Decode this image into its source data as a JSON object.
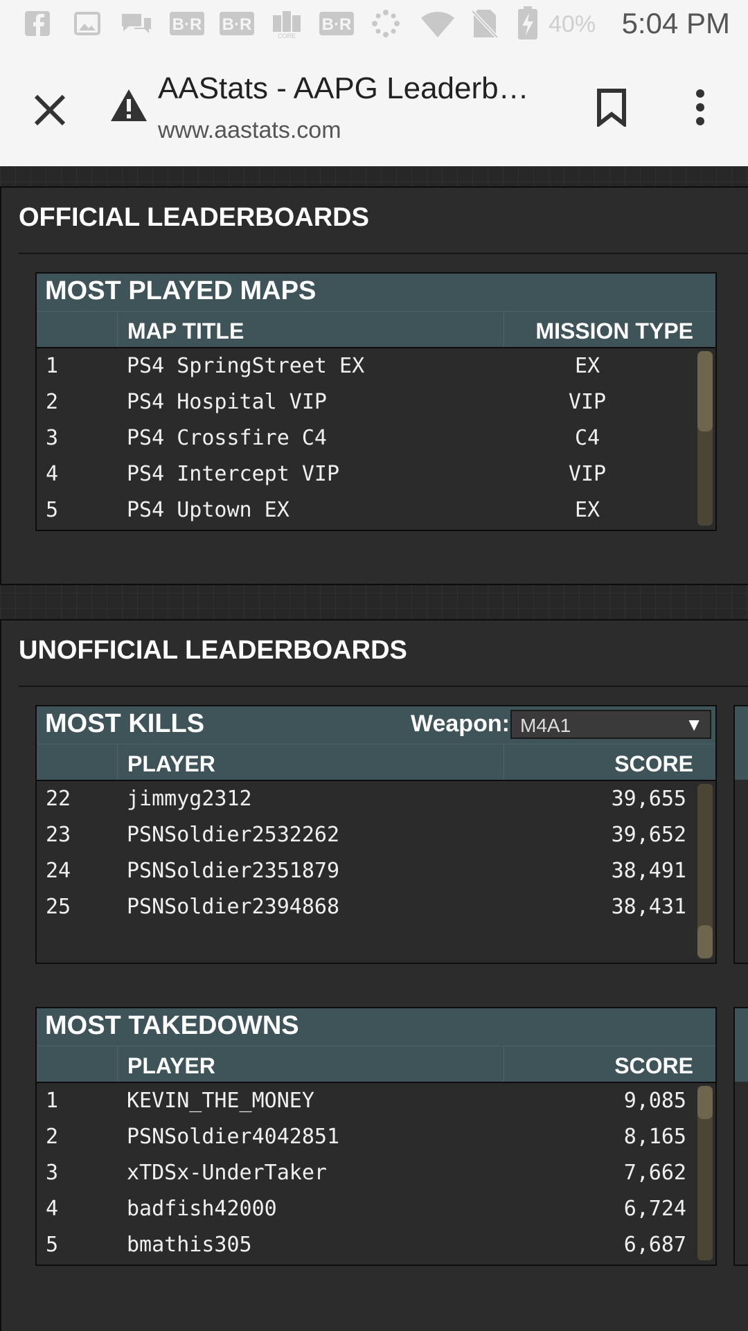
{
  "status_bar": {
    "time": "5:04 PM",
    "battery_percent": "40%",
    "icons": [
      "facebook-icon",
      "image-icon",
      "chat-icon",
      "b-r-icon",
      "b-r-icon",
      "core-icon",
      "b-r-icon",
      "dots-icon",
      "wifi-icon",
      "no-sim-icon",
      "battery-charging-icon"
    ]
  },
  "browser": {
    "title": "AAStats - AAPG Leaderb…",
    "url": "www.aastats.com",
    "icons": {
      "close": "close-icon",
      "warning": "warning-icon",
      "bookmark": "bookmark-icon",
      "menu": "more-vert-icon"
    }
  },
  "official": {
    "heading": "OFFICIAL LEADERBOARDS",
    "most_played_maps": {
      "title": "MOST PLAYED MAPS",
      "col_map": "MAP TITLE",
      "col_type": "MISSION TYPE",
      "rows": [
        {
          "rank": "1",
          "map": "PS4 SpringStreet EX",
          "type": "EX"
        },
        {
          "rank": "2",
          "map": "PS4 Hospital VIP",
          "type": "VIP"
        },
        {
          "rank": "3",
          "map": "PS4 Crossfire C4",
          "type": "C4"
        },
        {
          "rank": "4",
          "map": "PS4 Intercept VIP",
          "type": "VIP"
        },
        {
          "rank": "5",
          "map": "PS4 Uptown EX",
          "type": "EX"
        }
      ]
    }
  },
  "unofficial": {
    "heading": "UNOFFICIAL LEADERBOARDS",
    "most_kills": {
      "title": "MOST KILLS",
      "weapon_label": "Weapon:",
      "weapon_value": "M4A1",
      "col_player": "PLAYER",
      "col_score": "SCORE",
      "rows": [
        {
          "rank": "22",
          "player": "jimmyg2312",
          "score": "39,655"
        },
        {
          "rank": "23",
          "player": "PSNSoldier2532262",
          "score": "39,652"
        },
        {
          "rank": "24",
          "player": "PSNSoldier2351879",
          "score": "38,491"
        },
        {
          "rank": "25",
          "player": "PSNSoldier2394868",
          "score": "38,431"
        }
      ]
    },
    "most_takedowns": {
      "title": "MOST TAKEDOWNS",
      "col_player": "PLAYER",
      "col_score": "SCORE",
      "rows": [
        {
          "rank": "1",
          "player": "KEVIN_THE_MONEY",
          "score": "9,085"
        },
        {
          "rank": "2",
          "player": "PSNSoldier4042851",
          "score": "8,165"
        },
        {
          "rank": "3",
          "player": "xTDSx-UnderTaker",
          "score": "7,662"
        },
        {
          "rank": "4",
          "player": "badfish42000",
          "score": "6,724"
        },
        {
          "rank": "5",
          "player": "bmathis305",
          "score": "6,687"
        }
      ]
    }
  }
}
